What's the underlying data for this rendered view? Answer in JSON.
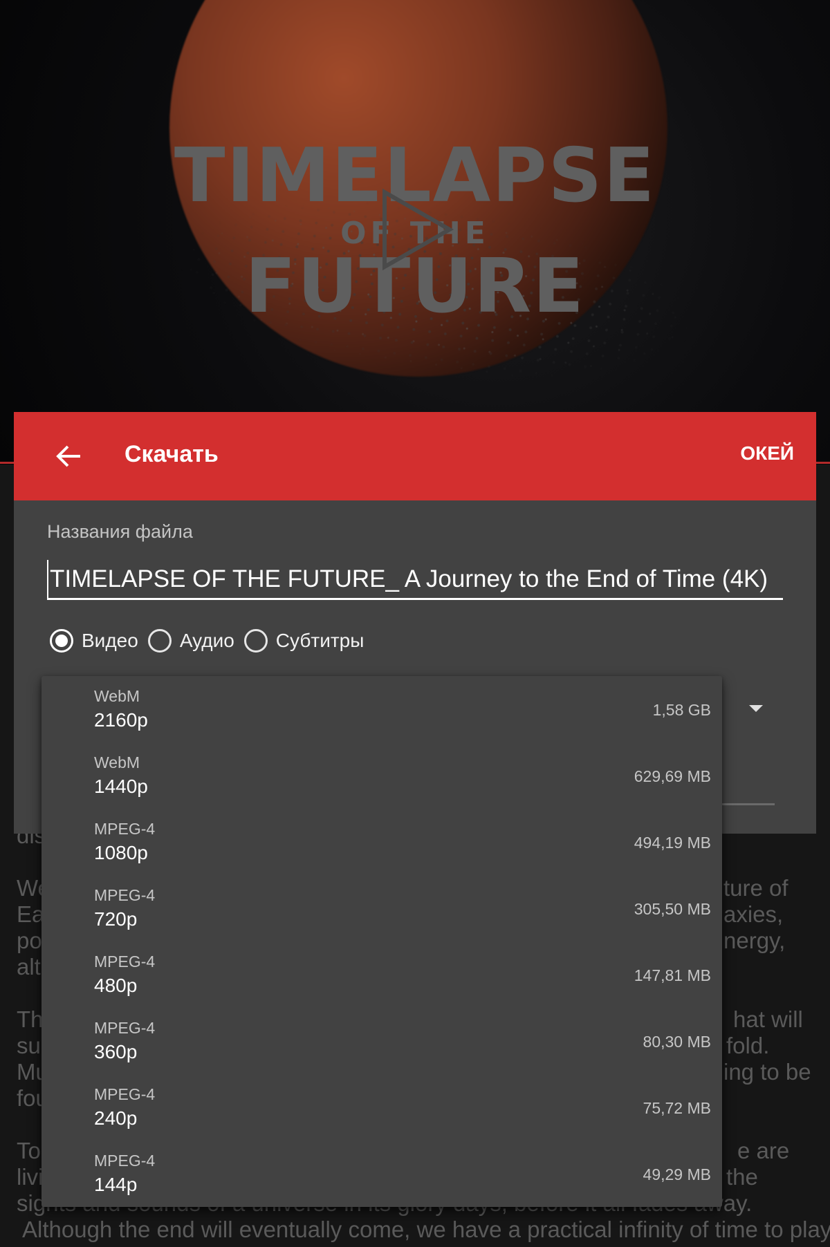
{
  "thumbnail": {
    "title_line1": "TIMELAPSE",
    "title_line2": "OF THE",
    "title_line3": "FUTURE",
    "play_icon": "play-icon"
  },
  "description": {
    "lines": [
      "dis",
      "We",
      "Ea",
      "po",
      "alt",
      "Th",
      "su",
      "Mu",
      "fou",
      "To",
      "livi",
      "sights and sounds of a universe in its glory days, before it all fades away.",
      "Although the end will eventually come, we have a practical infinity of time to play"
    ],
    "right_fragments": [
      "ture of",
      "axies,",
      "nergy,",
      "hat will",
      "fold.",
      "ing to be",
      "e are",
      "the"
    ]
  },
  "dialog": {
    "title": "Скачать",
    "back_icon": "arrow-left-icon",
    "ok_label": "ОКЕЙ",
    "accent_color": "#d32f2f",
    "filename_label": "Названия файла",
    "filename_value": "TIMELAPSE OF THE FUTURE_ A Journey to the End of Time (4K)",
    "radios": [
      {
        "label": "Видео",
        "checked": true
      },
      {
        "label": "Аудио",
        "checked": false
      },
      {
        "label": "Субтитры",
        "checked": false
      }
    ]
  },
  "dropdown": {
    "options": [
      {
        "format": "WebM",
        "resolution": "2160p",
        "size": "1,58 GB"
      },
      {
        "format": "WebM",
        "resolution": "1440p",
        "size": "629,69 MB"
      },
      {
        "format": "MPEG-4",
        "resolution": "1080p",
        "size": "494,19 MB"
      },
      {
        "format": "MPEG-4",
        "resolution": "720p",
        "size": "305,50 MB"
      },
      {
        "format": "MPEG-4",
        "resolution": "480p",
        "size": "147,81 MB"
      },
      {
        "format": "MPEG-4",
        "resolution": "360p",
        "size": "80,30 MB"
      },
      {
        "format": "MPEG-4",
        "resolution": "240p",
        "size": "75,72 MB"
      },
      {
        "format": "MPEG-4",
        "resolution": "144p",
        "size": "49,29 MB"
      }
    ]
  }
}
